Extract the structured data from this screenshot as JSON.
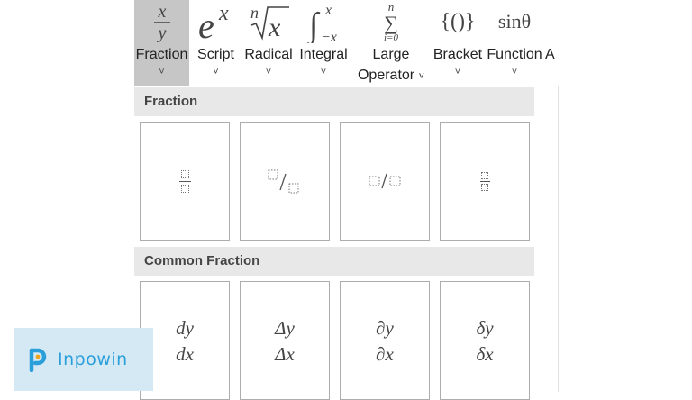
{
  "ribbon": {
    "fraction": {
      "label": "Fraction",
      "chevron": "˅"
    },
    "script": {
      "label": "Script",
      "chevron": "˅"
    },
    "radical": {
      "label": "Radical",
      "chevron": "˅"
    },
    "integral": {
      "label": "Integral",
      "chevron": "˅"
    },
    "large_operator": {
      "label_line1": "Large",
      "label_line2": "Operator",
      "chevron": "˅"
    },
    "bracket": {
      "label": "Bracket",
      "chevron": "˅",
      "symbol": "{()}"
    },
    "function": {
      "label": "Function",
      "chevron": "˅",
      "symbol": "sinθ"
    },
    "accent": {
      "label": "A"
    }
  },
  "sections": {
    "fraction": {
      "title": "Fraction"
    },
    "common_fraction": {
      "title": "Common Fraction",
      "items": [
        {
          "num": "dy",
          "den": "dx"
        },
        {
          "num": "Δy",
          "den": "Δx"
        },
        {
          "num": "∂y",
          "den": "∂x"
        },
        {
          "num": "δy",
          "den": "δx"
        }
      ]
    }
  },
  "watermark": {
    "brand": "Inpowin"
  },
  "colors": {
    "active_tab": "#c6c6c6",
    "section_header": "#e8e8e8",
    "brand": "#2a9fd9"
  }
}
